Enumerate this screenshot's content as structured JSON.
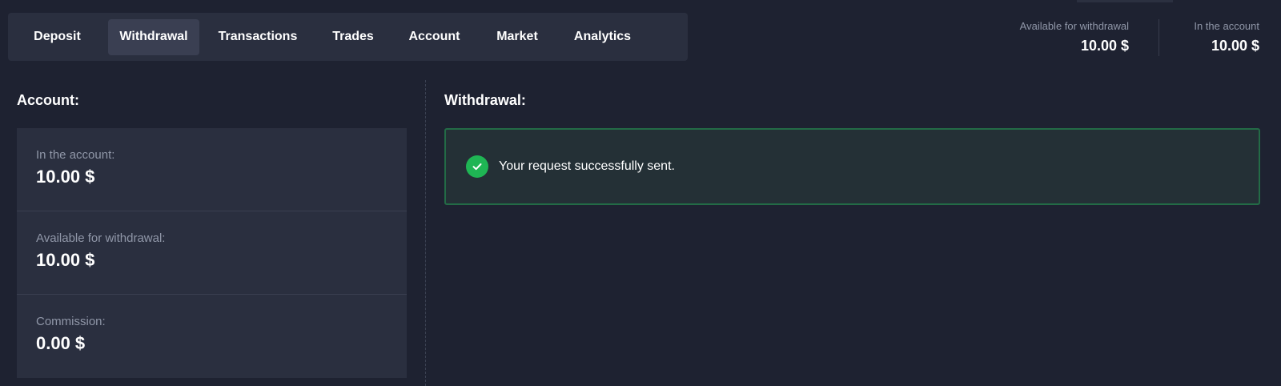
{
  "tabs": [
    {
      "label": "Deposit",
      "active": false
    },
    {
      "label": "Withdrawal",
      "active": true
    },
    {
      "label": "Transactions",
      "active": false
    },
    {
      "label": "Trades",
      "active": false
    },
    {
      "label": "Account",
      "active": false
    },
    {
      "label": "Market",
      "active": false
    },
    {
      "label": "Analytics",
      "active": false
    }
  ],
  "header": {
    "available": {
      "label": "Available for withdrawal",
      "value": "10.00 $"
    },
    "in_account": {
      "label": "In the account",
      "value": "10.00 $"
    }
  },
  "account_section": {
    "title": "Account:",
    "items": [
      {
        "label": "In the account:",
        "value": "10.00 $"
      },
      {
        "label": "Available for withdrawal:",
        "value": "10.00 $"
      },
      {
        "label": "Commission:",
        "value": "0.00 $"
      }
    ]
  },
  "withdrawal_section": {
    "title": "Withdrawal:",
    "success_message": "Your request successfully sent.",
    "success_icon": "check-circle-icon"
  },
  "colors": {
    "background": "#1e2231",
    "panel": "#2a2f3f",
    "success_border": "#236b46",
    "success_icon": "#1fb554"
  }
}
